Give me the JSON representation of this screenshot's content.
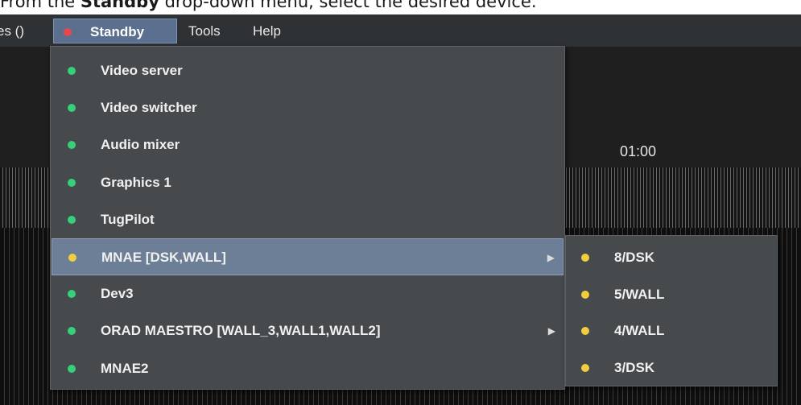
{
  "caption": {
    "before": "From the ",
    "bold": "Standby",
    "after": " drop-down menu, select the desired device."
  },
  "menubar": {
    "partial_label": "es ()",
    "standby_label": "Standby",
    "standby_status_color": "#e8484d",
    "tools_label": "Tools",
    "help_label": "Help"
  },
  "time_label": "01:00",
  "standby_menu": {
    "items": [
      {
        "label": "Video server",
        "status_color": "#37d07a",
        "has_submenu": false
      },
      {
        "label": "Video switcher",
        "status_color": "#37d07a",
        "has_submenu": false
      },
      {
        "label": "Audio mixer",
        "status_color": "#37d07a",
        "has_submenu": false
      },
      {
        "label": "Graphics 1",
        "status_color": "#37d07a",
        "has_submenu": false
      },
      {
        "label": "TugPilot",
        "status_color": "#37d07a",
        "has_submenu": false
      },
      {
        "label": "MNAE [DSK,WALL]",
        "status_color": "#f2cd3e",
        "has_submenu": true,
        "highlighted": true
      },
      {
        "label": "Dev3",
        "status_color": "#37d07a",
        "has_submenu": false
      },
      {
        "label": "ORAD MAESTRO [WALL_3,WALL1,WALL2]",
        "status_color": "#37d07a",
        "has_submenu": true
      },
      {
        "label": "MNAE2",
        "status_color": "#37d07a",
        "has_submenu": false
      }
    ],
    "submenu_arrow": "▶"
  },
  "submenu": {
    "items": [
      {
        "label": "8/DSK",
        "status_color": "#f2cd3e"
      },
      {
        "label": "5/WALL",
        "status_color": "#f2cd3e"
      },
      {
        "label": "4/WALL",
        "status_color": "#f2cd3e"
      },
      {
        "label": "3/DSK",
        "status_color": "#f2cd3e"
      }
    ]
  }
}
